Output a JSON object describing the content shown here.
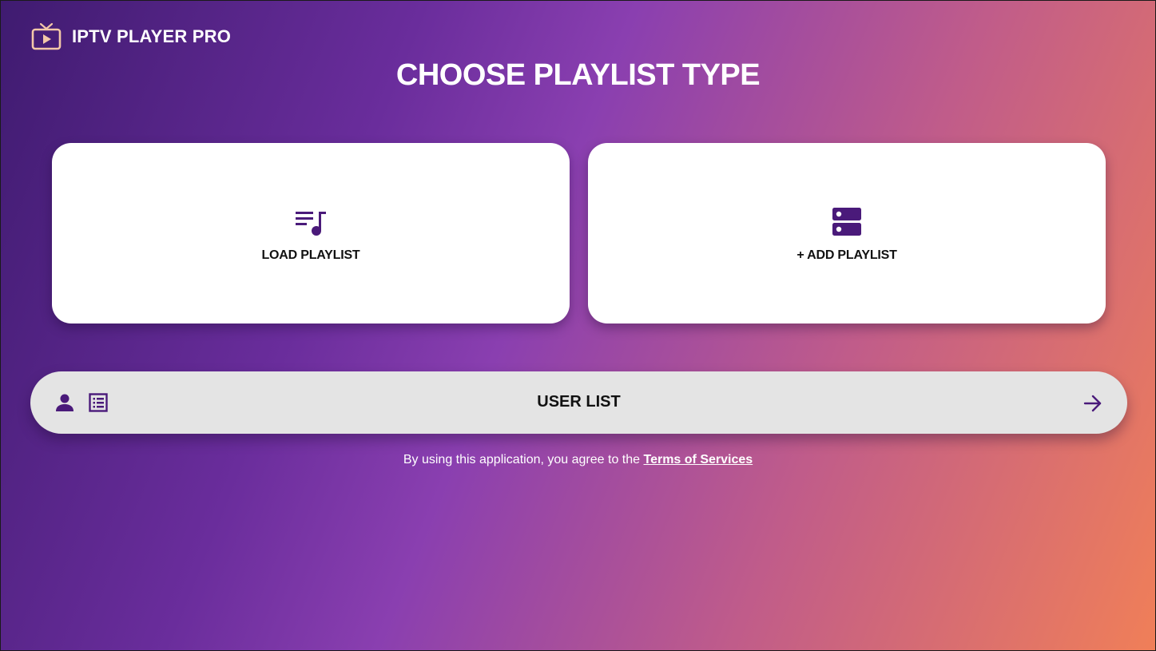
{
  "app": {
    "name": "IPTV PLAYER PRO",
    "logo_icon": "tv-play-icon"
  },
  "page": {
    "title": "CHOOSE PLAYLIST TYPE"
  },
  "cards": {
    "load": {
      "label": "LOAD PLAYLIST",
      "icon": "playlist-music-icon"
    },
    "add": {
      "label": "+ ADD PLAYLIST",
      "icon": "storage-icon"
    }
  },
  "user_list": {
    "label": "USER LIST",
    "icons": [
      "person-icon",
      "list-icon"
    ],
    "action_icon": "arrow-right-icon"
  },
  "terms": {
    "prefix": "By using this application, you agree to the",
    "link": "Terms of Services"
  },
  "colors": {
    "accent": "#4a1a7a",
    "logo": "#f3c8a8",
    "gradient_start": "#3f1b70",
    "gradient_end": "#f07f58"
  }
}
